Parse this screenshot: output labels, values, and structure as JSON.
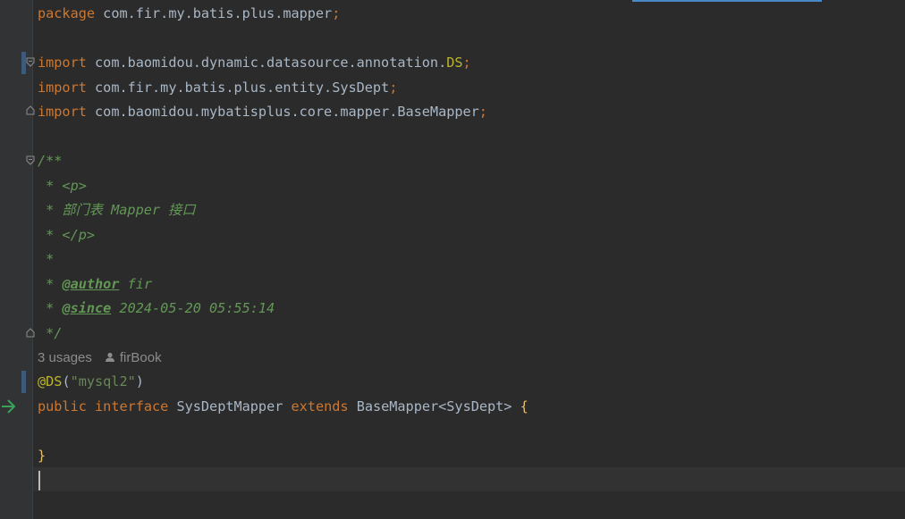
{
  "code": {
    "package_kw": "package",
    "package_name": "com.fir.my.batis.plus.mapper",
    "semi": ";",
    "imports": [
      {
        "kw": "import",
        "path": "com.baomidou.dynamic.datasource.annotation.",
        "last": "DS",
        "last_is_annotation": true
      },
      {
        "kw": "import",
        "path": "com.fir.my.batis.plus.entity.SysDept",
        "last": "",
        "last_is_annotation": false
      },
      {
        "kw": "import",
        "path": "com.baomidou.mybatisplus.core.mapper.BaseMapper",
        "last": "",
        "last_is_annotation": false
      }
    ],
    "doc": {
      "open": "/**",
      "lines": [
        " * <p>",
        " * 部门表 Mapper 接口",
        " * </p>",
        " *"
      ],
      "author_prefix": " * ",
      "author_tag": "@author",
      "author_value": " fir",
      "since_prefix": " * ",
      "since_tag": "@since",
      "since_value": " 2024-05-20 05:55:14",
      "close": " */"
    },
    "hints": {
      "usages": "3 usages",
      "author": "firBook"
    },
    "annotation": {
      "name": "@DS",
      "open_paren": "(",
      "value": "\"mysql2\"",
      "close_paren": ")"
    },
    "declaration": {
      "public_kw": "public",
      "interface_kw": "interface",
      "name": "SysDeptMapper",
      "extends_kw": "extends",
      "base": "BaseMapper",
      "generic_open": "<",
      "generic": "SysDept",
      "generic_close": ">",
      "open_brace": "{",
      "close_brace": "}"
    }
  },
  "icons": {
    "fold": "fold-marker-icon",
    "run": "implementation-arrow-icon",
    "person": "person-icon"
  },
  "colors": {
    "background": "#2b2b2b",
    "keyword": "#cc7832",
    "annotation": "#bbb529",
    "string": "#6a8759",
    "comment": "#629755",
    "text": "#a9b7c6"
  }
}
